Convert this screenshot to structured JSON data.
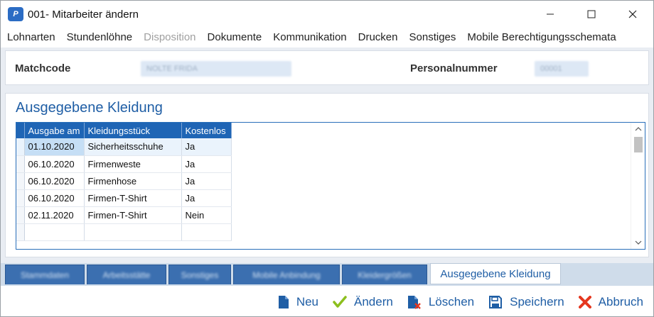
{
  "window": {
    "icon_text": "P",
    "title": "001- Mitarbeiter ändern"
  },
  "menu": [
    {
      "label": "Lohnarten",
      "disabled": false
    },
    {
      "label": "Stundenlöhne",
      "disabled": false
    },
    {
      "label": "Disposition",
      "disabled": true
    },
    {
      "label": "Dokumente",
      "disabled": false
    },
    {
      "label": "Kommunikation",
      "disabled": false
    },
    {
      "label": "Drucken",
      "disabled": false
    },
    {
      "label": "Sonstiges",
      "disabled": false
    },
    {
      "label": "Mobile Berechtigungsschemata",
      "disabled": false
    }
  ],
  "header": {
    "matchcode_label": "Matchcode",
    "matchcode_value": "NOLTE FRIDA",
    "personalnummer_label": "Personalnummer",
    "personalnummer_value": "00001"
  },
  "section": {
    "title": "Ausgegebene Kleidung"
  },
  "grid": {
    "columns": [
      "Ausgabe am",
      "Kleidungsstück",
      "Kostenlos"
    ],
    "rows": [
      [
        "01.10.2020",
        "Sicherheitsschuhe",
        "Ja"
      ],
      [
        "06.10.2020",
        "Firmenweste",
        "Ja"
      ],
      [
        "06.10.2020",
        "Firmenhose",
        "Ja"
      ],
      [
        "06.10.2020",
        "Firmen-T-Shirt",
        "Ja"
      ],
      [
        "02.11.2020",
        "Firmen-T-Shirt",
        "Nein"
      ]
    ]
  },
  "tabs": [
    {
      "label": "Stammdaten",
      "active": false
    },
    {
      "label": "Arbeitsstätte",
      "active": false
    },
    {
      "label": "Sonstiges",
      "active": false
    },
    {
      "label": "Mobile Anbindung",
      "active": false
    },
    {
      "label": "Kleidergrößen",
      "active": false
    },
    {
      "label": "Ausgegebene Kleidung",
      "active": true
    }
  ],
  "toolbar": {
    "new_label": "Neu",
    "edit_label": "Ändern",
    "delete_label": "Löschen",
    "save_label": "Speichern",
    "cancel_label": "Abbruch"
  },
  "colors": {
    "accent": "#1f5ea5",
    "grid_header": "#1f65b5",
    "edit_check": "#8cbf1e",
    "cancel_x": "#e5371f",
    "content_bg": "#e9edf3"
  }
}
